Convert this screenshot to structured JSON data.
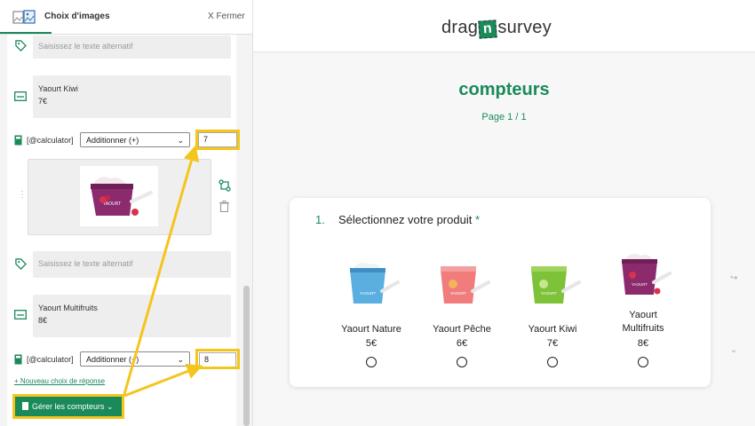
{
  "left_panel": {
    "title": "Choix d'images",
    "close_label": "X Fermer",
    "alt_placeholder": "Saisissez le texte alternatif",
    "items": [
      {
        "desc_name": "Yaourt Kiwi",
        "desc_price": "7€",
        "calc_label": "[@calculator]",
        "operation": "Additionner (+)",
        "value": "7"
      },
      {
        "desc_name": "Yaourt Multifruits",
        "desc_price": "8€",
        "calc_label": "[@calculator]",
        "operation": "Additionner (+)",
        "value": "8"
      }
    ],
    "new_choice_link": "+ Nouveau choix de réponse",
    "manage_button": "Gérer les compteurs"
  },
  "brand": {
    "part1": "drag",
    "part2": "n",
    "part3": "survey"
  },
  "survey": {
    "title": "compteurs",
    "page_indicator": "Page 1 / 1"
  },
  "question": {
    "number": "1.",
    "text": "Sélectionnez votre produit",
    "required_mark": "*",
    "choices": [
      {
        "label": "Yaourt Nature",
        "price": "5€",
        "color": "#5aaee0"
      },
      {
        "label": "Yaourt Pêche",
        "price": "6€",
        "color": "#f07c7c"
      },
      {
        "label": "Yaourt Kiwi",
        "price": "7€",
        "color": "#7ec23a"
      },
      {
        "label": "Yaourt\nMultifruits",
        "price": "8€",
        "color": "#8c2a6e"
      }
    ]
  },
  "colors": {
    "brand_green": "#1a8a5a",
    "highlight_yellow": "#f4c51c"
  }
}
